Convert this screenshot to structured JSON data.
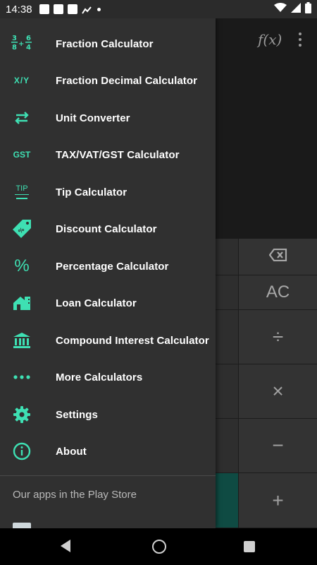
{
  "status_bar": {
    "time": "14:38",
    "notification_icons": [
      "nrg-icon",
      "inq-icon",
      "e-icon",
      "chart-icon"
    ]
  },
  "background_app": {
    "fx_label": "f(x)",
    "keys": {
      "backspace": "backspace-icon",
      "clear": "AC",
      "divide": "÷",
      "multiply": "×",
      "minus": "−",
      "plus": "+"
    }
  },
  "drawer": {
    "items": [
      {
        "label": "Fraction Calculator",
        "icon": "fraction-icon"
      },
      {
        "label": "Fraction Decimal Calculator",
        "icon": "x-over-y-icon",
        "icon_text": "X/Y"
      },
      {
        "label": "Unit Converter",
        "icon": "swap-arrows-icon"
      },
      {
        "label": "TAX/VAT/GST Calculator",
        "icon": "gst-icon",
        "icon_text": "GST"
      },
      {
        "label": "Tip Calculator",
        "icon": "tip-icon",
        "icon_text": "TIP"
      },
      {
        "label": "Discount Calculator",
        "icon": "discount-tag-icon"
      },
      {
        "label": "Percentage Calculator",
        "icon": "percent-icon",
        "icon_text": "%"
      },
      {
        "label": "Loan Calculator",
        "icon": "house-loan-icon"
      },
      {
        "label": "Compound Interest Calculator",
        "icon": "bank-icon"
      },
      {
        "label": "More Calculators",
        "icon": "more-dots-icon"
      },
      {
        "label": "Settings",
        "icon": "gear-icon"
      },
      {
        "label": "About",
        "icon": "info-icon"
      }
    ],
    "section_title": "Our apps in the Play Store"
  },
  "colors": {
    "accent": "#3ee0b3",
    "drawer_bg": "#303030",
    "teal_key": "#0f4b43"
  }
}
